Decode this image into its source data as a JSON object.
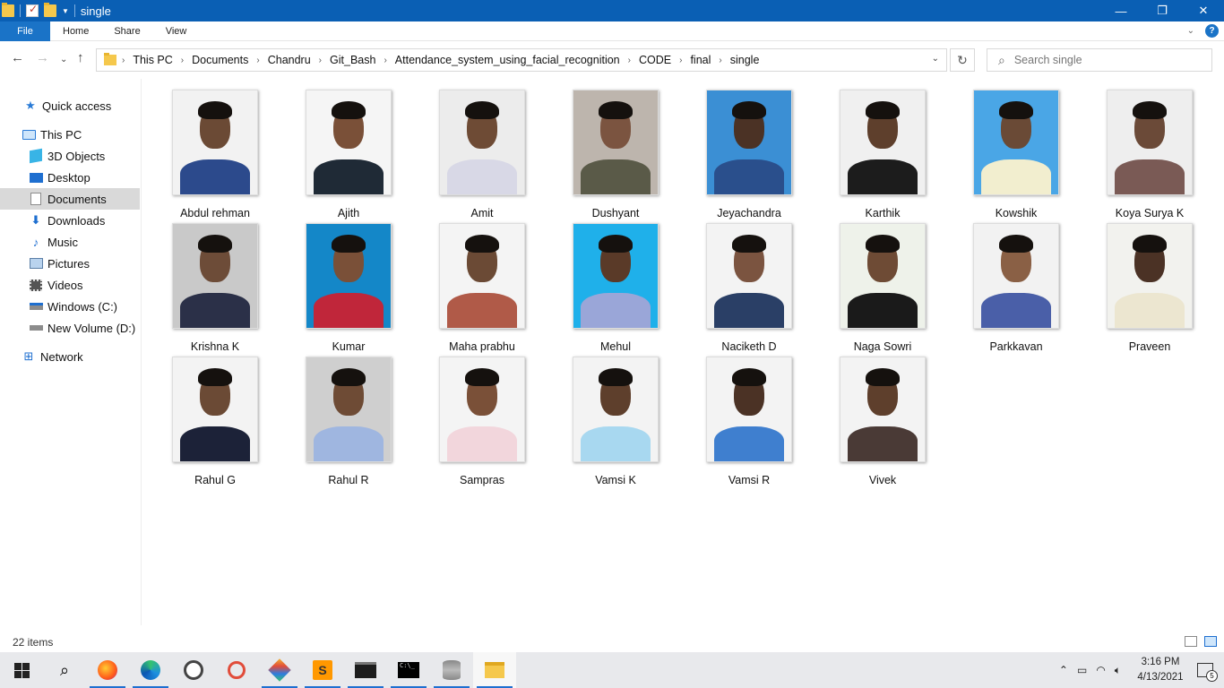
{
  "window": {
    "title": "single",
    "controls": {
      "minimize": "—",
      "maximize": "❐",
      "close": "✕"
    }
  },
  "ribbon": {
    "tabs": [
      "File",
      "Home",
      "Share",
      "View"
    ]
  },
  "address": {
    "breadcrumbs": [
      "This PC",
      "Documents",
      "Chandru",
      "Git_Bash",
      "Attendance_system_using_facial_recognition",
      "CODE",
      "final",
      "single"
    ]
  },
  "search": {
    "placeholder": "Search single"
  },
  "sidebar": {
    "items": [
      {
        "label": "Quick access",
        "icon": "star-icon"
      },
      {
        "label": "This PC",
        "icon": "computer-icon"
      },
      {
        "label": "3D Objects",
        "icon": "cube-icon"
      },
      {
        "label": "Desktop",
        "icon": "desktop-icon"
      },
      {
        "label": "Documents",
        "icon": "document-icon",
        "selected": true
      },
      {
        "label": "Downloads",
        "icon": "download-icon"
      },
      {
        "label": "Music",
        "icon": "music-icon"
      },
      {
        "label": "Pictures",
        "icon": "pictures-icon"
      },
      {
        "label": "Videos",
        "icon": "videos-icon"
      },
      {
        "label": "Windows (C:)",
        "icon": "drive-icon"
      },
      {
        "label": "New Volume (D:)",
        "icon": "drive-icon"
      },
      {
        "label": "Network",
        "icon": "network-icon"
      }
    ]
  },
  "files": [
    {
      "name": "Abdul rehman",
      "bg": "#f2f2f2",
      "shirt": "#2c4a8c",
      "skin": "#6b4a35"
    },
    {
      "name": "Ajith",
      "bg": "#f5f5f5",
      "shirt": "#1f2a36",
      "skin": "#7a5038"
    },
    {
      "name": "Amit",
      "bg": "#ececec",
      "shirt": "#d8d8e6",
      "skin": "#6e4b35"
    },
    {
      "name": "Dushyant",
      "bg": "#bdb5ad",
      "shirt": "#5a5a48",
      "skin": "#7b5440"
    },
    {
      "name": "Jeyachandra",
      "bg": "#3b8fd4",
      "shirt": "#2a4f8c",
      "skin": "#4b3225"
    },
    {
      "name": "Karthik",
      "bg": "#f0f0f0",
      "shirt": "#1c1c1c",
      "skin": "#5e3f2c"
    },
    {
      "name": "Kowshik",
      "bg": "#4aa6e6",
      "shirt": "#f2eecf",
      "skin": "#6a4a36"
    },
    {
      "name": "Koya Surya K",
      "bg": "#eeeeee",
      "shirt": "#7a5a55",
      "skin": "#6b4a38"
    },
    {
      "name": "Krishna K",
      "bg": "#c9c9c9",
      "shirt": "#2b3048",
      "skin": "#6d4c38"
    },
    {
      "name": "Kumar",
      "bg": "#1487c8",
      "shirt": "#c0263a",
      "skin": "#7a5038"
    },
    {
      "name": "Maha prabhu",
      "bg": "#f4f4f4",
      "shirt": "#b05a48",
      "skin": "#6b4a35"
    },
    {
      "name": "Mehul",
      "bg": "#1fb0ea",
      "shirt": "#9aa6d8",
      "skin": "#5a3a28"
    },
    {
      "name": "Naciketh D",
      "bg": "#f3f3f3",
      "shirt": "#2a3f66",
      "skin": "#7b5440"
    },
    {
      "name": "Naga Sowri",
      "bg": "#eef2ea",
      "shirt": "#1a1a1a",
      "skin": "#6e4b35"
    },
    {
      "name": "Parkkavan",
      "bg": "#f2f2f2",
      "shirt": "#4a5fa8",
      "skin": "#8a6045"
    },
    {
      "name": "Praveen",
      "bg": "#f2f2ee",
      "shirt": "#ece6d0",
      "skin": "#4b3225"
    },
    {
      "name": "Rahul G",
      "bg": "#f3f3f3",
      "shirt": "#1c2238",
      "skin": "#6b4a35"
    },
    {
      "name": "Rahul R",
      "bg": "#cfcfcf",
      "shirt": "#9fb6e0",
      "skin": "#6e4b35"
    },
    {
      "name": "Sampras",
      "bg": "#f4f4f4",
      "shirt": "#f2d6dc",
      "skin": "#7a5038"
    },
    {
      "name": "Vamsi K",
      "bg": "#f3f3f3",
      "shirt": "#a8d8f0",
      "skin": "#5e3f2c"
    },
    {
      "name": "Vamsi R",
      "bg": "#f3f3f3",
      "shirt": "#3f7fcf",
      "skin": "#4b3225"
    },
    {
      "name": "Vivek",
      "bg": "#f3f3f3",
      "shirt": "#4a3a36",
      "skin": "#5e3f2c"
    }
  ],
  "status": {
    "item_count": "22 items"
  },
  "taskbar": {
    "apps": [
      "start-icon",
      "search-icon",
      "firefox-icon",
      "edge-icon",
      "clock-app-icon",
      "git-app-icon",
      "gitkraken-icon",
      "sublime-text-icon",
      "terminal-icon",
      "command-prompt-icon",
      "database-icon",
      "file-explorer-icon"
    ],
    "time": "3:16 PM",
    "date": "4/13/2021",
    "notification_count": "5"
  },
  "colors": {
    "titlebar": "#0a5fb4",
    "accent": "#1a73c7",
    "selected_nav": "#d9d9d9"
  }
}
